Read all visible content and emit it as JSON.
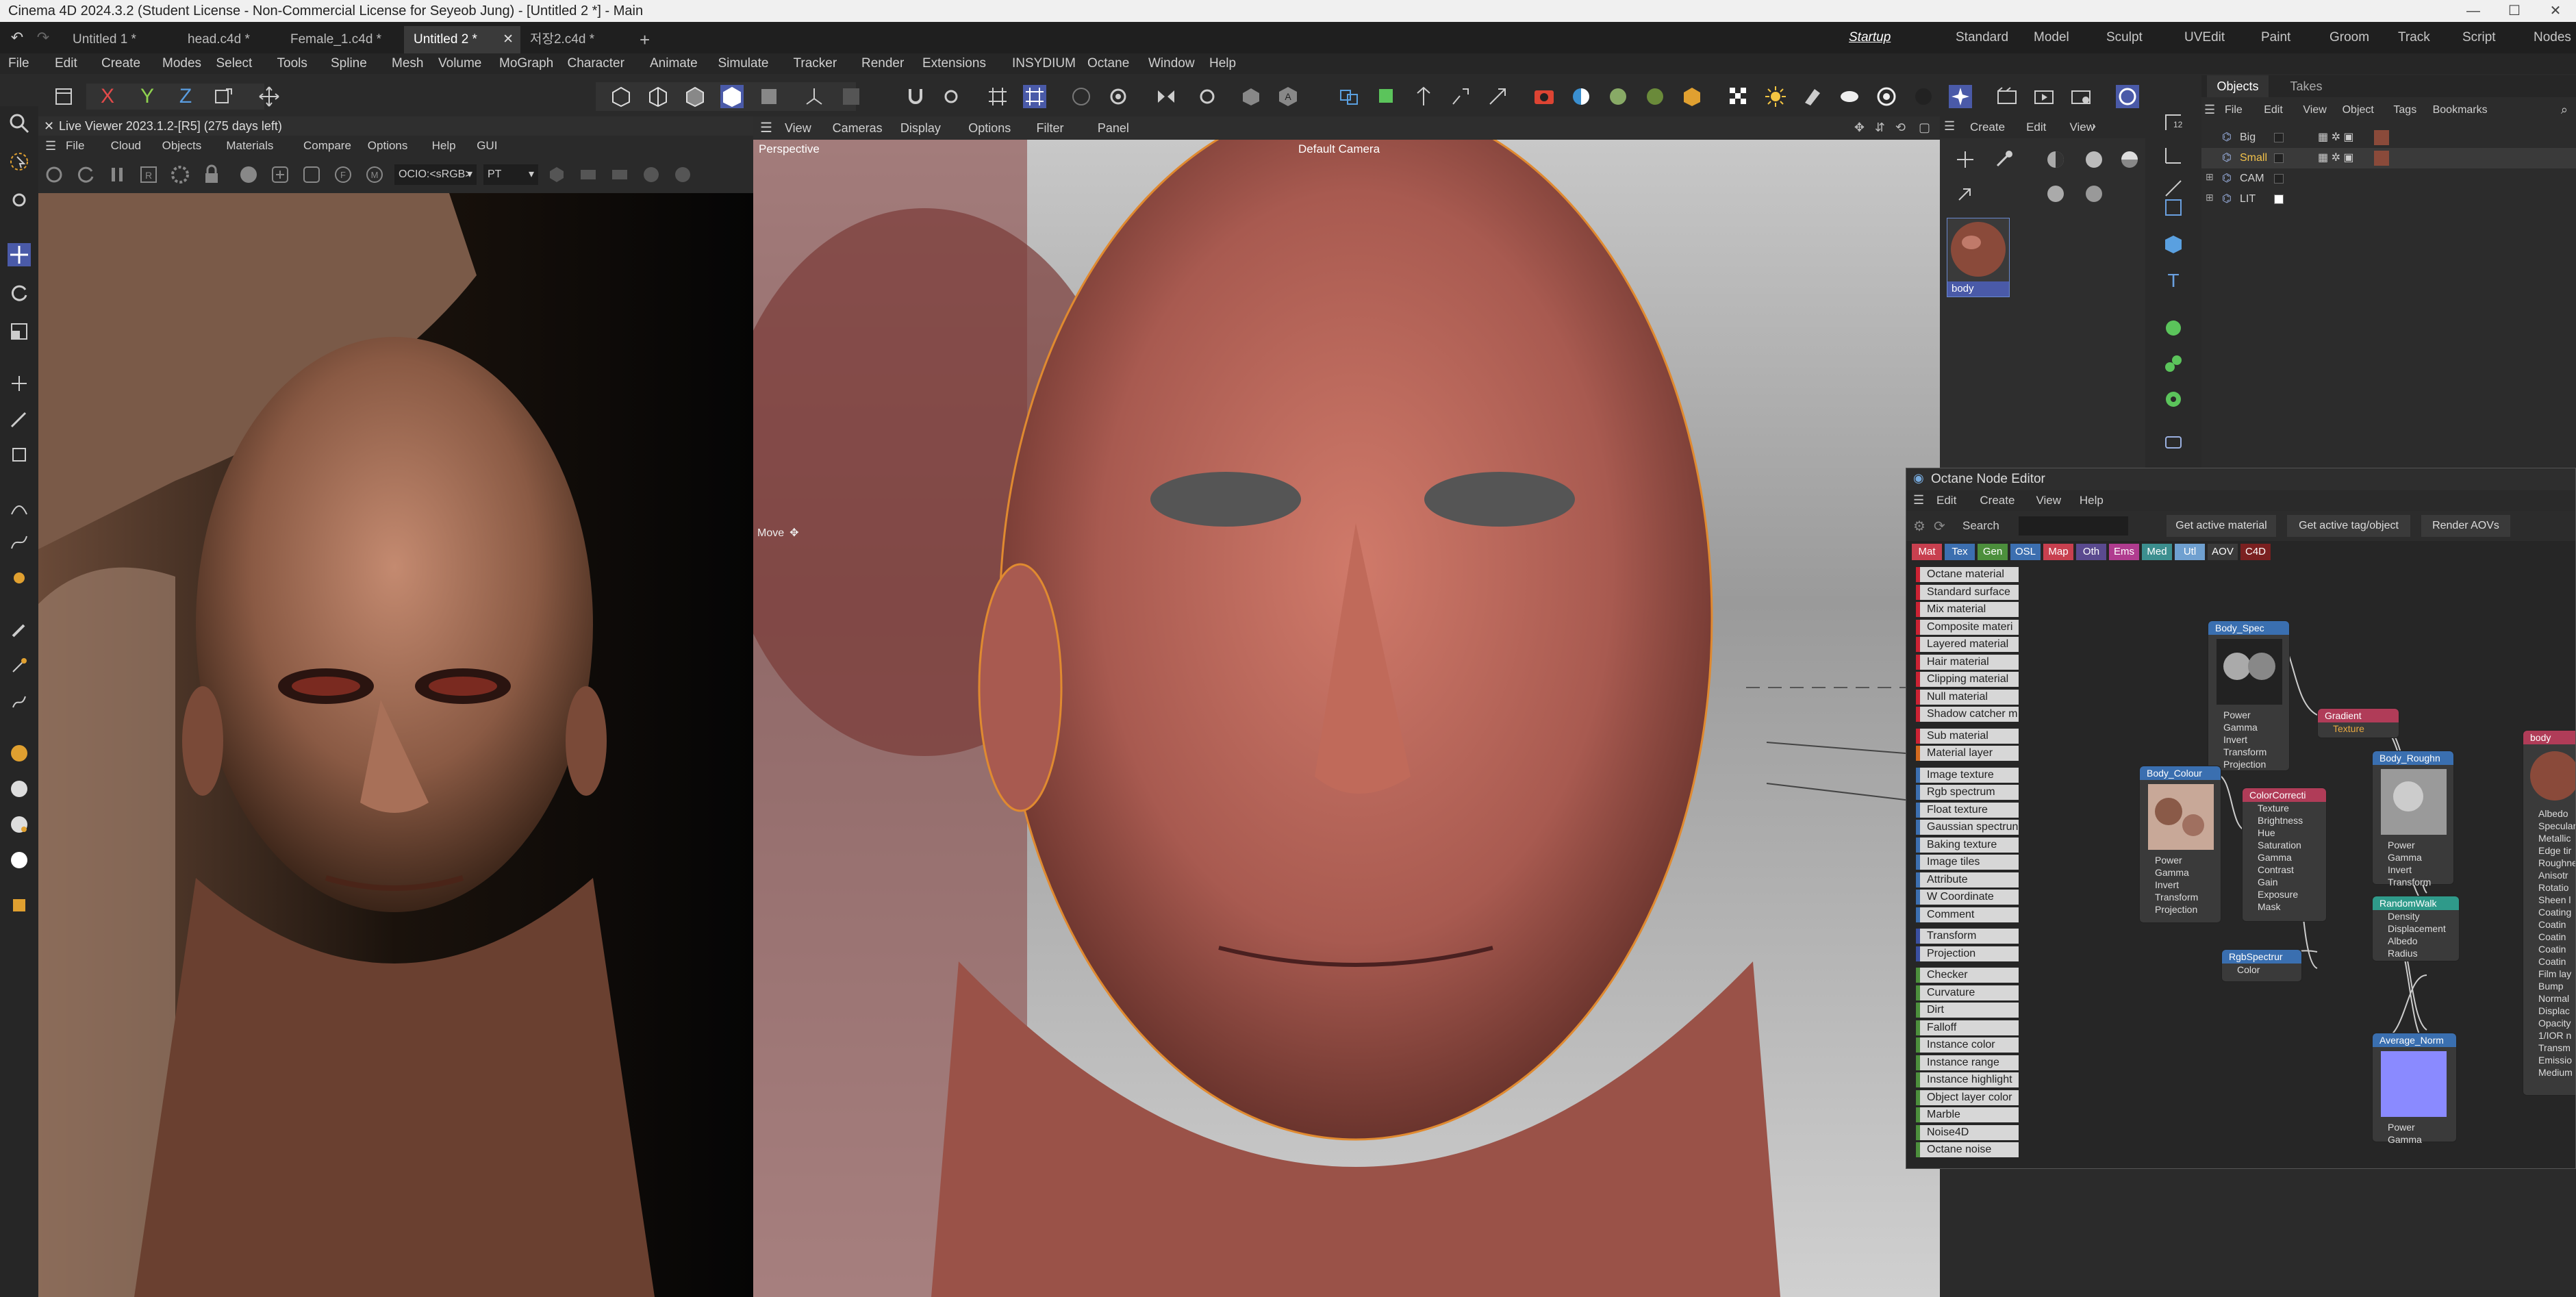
{
  "window": {
    "title": "Cinema 4D 2024.3.2 (Student License - Non-Commercial License for Seyeob Jung) - [Untitled 2 *] - Main"
  },
  "doc_tabs": [
    "Untitled 1 *",
    "head.c4d *",
    "Female_1.c4d *",
    "Untitled 2 *",
    "저장2.c4d *"
  ],
  "active_doc_tab": 3,
  "add_tab": "+",
  "layouts": [
    "Startup",
    "Standard",
    "Model",
    "Sculpt",
    "UVEdit",
    "Paint",
    "Groom",
    "Track",
    "Script",
    "Nodes"
  ],
  "menu": [
    "File",
    "Edit",
    "Create",
    "Modes",
    "Select",
    "Tools",
    "Spline",
    "Mesh",
    "Volume",
    "MoGraph",
    "Character",
    "Animate",
    "Simulate",
    "Tracker",
    "Render",
    "Extensions",
    "INSYDIUM",
    "Octane",
    "Window",
    "Help"
  ],
  "axes": {
    "x": "X",
    "y": "Y",
    "z": "Z"
  },
  "live_viewer": {
    "title": "Live Viewer 2023.1.2-[R5] (275 days left)",
    "menu": [
      "File",
      "Cloud",
      "Objects",
      "Materials",
      "Compare",
      "Options",
      "Help",
      "GUI"
    ],
    "ocio": "OCIO:<sRGB>",
    "mode": "PT"
  },
  "viewport": {
    "menu": [
      "View",
      "Cameras",
      "Display",
      "Options",
      "Filter",
      "Panel"
    ],
    "label": "Perspective",
    "camera": "Default Camera",
    "move_label": "Move"
  },
  "material_manager": {
    "menu": [
      "Create",
      "Edit",
      "View"
    ],
    "material_name": "body"
  },
  "object_manager": {
    "tabs": [
      "Objects",
      "Takes"
    ],
    "menu": [
      "File",
      "Edit",
      "View",
      "Object",
      "Tags",
      "Bookmarks"
    ],
    "objects": [
      {
        "name": "Big",
        "color": "#cfcfcf"
      },
      {
        "name": "Small",
        "color": "#f3c24a"
      },
      {
        "name": "CAM",
        "color": "#cfcfcf"
      },
      {
        "name": "LIT",
        "color": "#cfcfcf"
      }
    ]
  },
  "node_editor": {
    "title": "Octane Node Editor",
    "menu": [
      "Edit",
      "Create",
      "View",
      "Help"
    ],
    "search_label": "Search",
    "buttons": [
      "Get active material",
      "Get active tag/object",
      "Render AOVs"
    ],
    "filters": [
      {
        "t": "Mat",
        "c": "#c8404f"
      },
      {
        "t": "Tex",
        "c": "#3c6fb0"
      },
      {
        "t": "Gen",
        "c": "#4c8f3c"
      },
      {
        "t": "OSL",
        "c": "#3c6fb0"
      },
      {
        "t": "Map",
        "c": "#c8404f"
      },
      {
        "t": "Oth",
        "c": "#5a4a8f"
      },
      {
        "t": "Ems",
        "c": "#b03c8f"
      },
      {
        "t": "Med",
        "c": "#3c8f8f"
      },
      {
        "t": "Utl",
        "c": "#6fa0d0"
      },
      {
        "t": "AOV",
        "c": "#3a3a3a"
      },
      {
        "t": "C4D",
        "c": "#7a2020"
      }
    ],
    "categories": [
      {
        "t": "Octane material",
        "c": "#c23"
      },
      {
        "t": "Standard surface",
        "c": "#c23"
      },
      {
        "t": "Mix material",
        "c": "#c23"
      },
      {
        "t": "Composite materi",
        "c": "#c23"
      },
      {
        "t": "Layered material",
        "c": "#c23"
      },
      {
        "t": "Hair material",
        "c": "#c23"
      },
      {
        "t": "Clipping material",
        "c": "#c23"
      },
      {
        "t": "Null material",
        "c": "#c23"
      },
      {
        "t": "Shadow catcher m",
        "c": "#c23"
      },
      {
        "t": "Sub material",
        "c": "#c23"
      },
      {
        "t": "Material layer",
        "c": "#d2691e"
      },
      {
        "t": "Image texture",
        "c": "#3c6fb0"
      },
      {
        "t": "Rgb spectrum",
        "c": "#3c6fb0"
      },
      {
        "t": "Float texture",
        "c": "#3c6fb0"
      },
      {
        "t": "Gaussian spectrun",
        "c": "#3c6fb0"
      },
      {
        "t": "Baking texture",
        "c": "#3c6fb0"
      },
      {
        "t": "Image tiles",
        "c": "#3c6fb0"
      },
      {
        "t": "Attribute",
        "c": "#3c6fb0"
      },
      {
        "t": "W Coordinate",
        "c": "#3c6fb0"
      },
      {
        "t": "Comment",
        "c": "#3c6fb0"
      },
      {
        "t": "Transform",
        "c": "#3a4fa0"
      },
      {
        "t": "Projection",
        "c": "#3a4fa0"
      },
      {
        "t": "Checker",
        "c": "#4c8f3c"
      },
      {
        "t": "Curvature",
        "c": "#4c8f3c"
      },
      {
        "t": "Dirt",
        "c": "#4c8f3c"
      },
      {
        "t": "Falloff",
        "c": "#4c8f3c"
      },
      {
        "t": "Instance color",
        "c": "#4c8f3c"
      },
      {
        "t": "Instance range",
        "c": "#4c8f3c"
      },
      {
        "t": "Instance highlight",
        "c": "#4c8f3c"
      },
      {
        "t": "Object layer color",
        "c": "#4c8f3c"
      },
      {
        "t": "Marble",
        "c": "#4c8f3c"
      },
      {
        "t": "Noise4D",
        "c": "#4c8f3c"
      },
      {
        "t": "Octane noise",
        "c": "#4c8f3c"
      }
    ],
    "nodes": {
      "body_spec": {
        "title": "Body_Spec",
        "ports": [
          "Power",
          "Gamma",
          "Invert",
          "Transform",
          "Projection"
        ]
      },
      "gradient": {
        "title": "Gradient",
        "ports": [
          "Texture"
        ]
      },
      "body_colour": {
        "title": "Body_Colour",
        "ports": [
          "Power",
          "Gamma",
          "Invert",
          "Transform",
          "Projection"
        ]
      },
      "color_correction": {
        "title": "ColorCorrecti",
        "ports": [
          "Texture",
          "Brightness",
          "Hue",
          "Saturation",
          "Gamma",
          "Contrast",
          "Gain",
          "Exposure",
          "Mask"
        ]
      },
      "body_rough": {
        "title": "Body_Roughn",
        "ports": [
          "Power",
          "Gamma",
          "Invert",
          "Transform"
        ]
      },
      "random_walk": {
        "title": "RandomWalk",
        "ports": [
          "Density",
          "Displacement",
          "Albedo",
          "Radius"
        ]
      },
      "rgb_spectrum": {
        "title": "RgbSpectrur",
        "ports": [
          "Color"
        ]
      },
      "average_normal": {
        "title": "Average_Norm",
        "ports": [
          "Power",
          "Gamma"
        ]
      },
      "body_mat": {
        "title": "body",
        "ports": [
          "Albedo",
          "Specular",
          "Metallic",
          "Edge tir",
          "Roughne",
          "Anisotr",
          "Rotatio",
          "Sheen l",
          "Coating",
          "Coatin",
          "Coatin",
          "Coatin",
          "Coatin",
          "Film lay",
          "Bump",
          "Normal",
          "Displac",
          "Opacity",
          "1/IOR n",
          "Transm",
          "Emissio",
          "Medium"
        ]
      }
    }
  }
}
